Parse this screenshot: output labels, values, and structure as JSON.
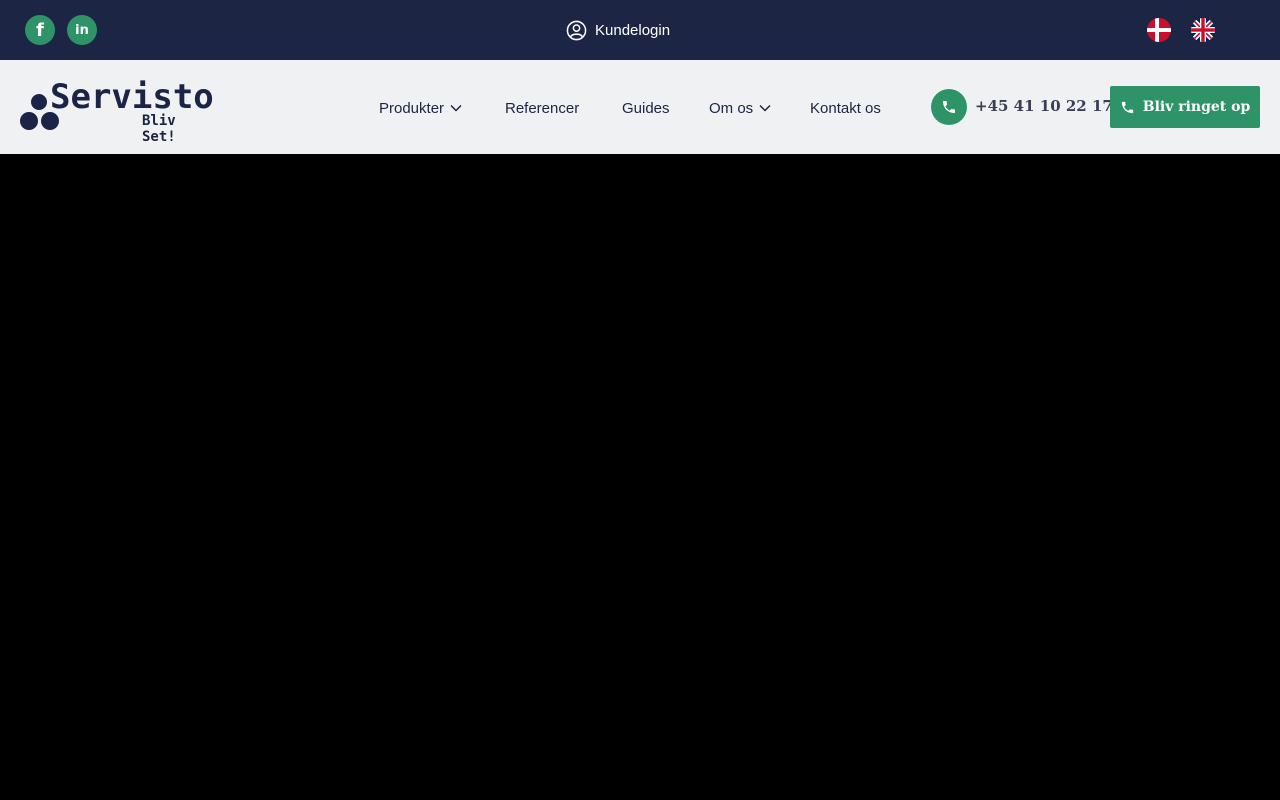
{
  "colors": {
    "topbar_bg": "#1d2545",
    "header_bg": "#f0f1f3",
    "accent_green": "#2e9367",
    "brand_navy": "#1b2446",
    "hero_bg": "#000000"
  },
  "topbar": {
    "social": [
      {
        "icon": "facebook-icon",
        "glyph": "f"
      },
      {
        "icon": "linkedin-icon",
        "glyph": "in"
      }
    ],
    "login_label": "Kundelogin",
    "languages": [
      {
        "icon": "danish-flag-icon"
      },
      {
        "icon": "uk-flag-icon"
      }
    ]
  },
  "header": {
    "logo": {
      "word": "Servisto",
      "tagline": "Bliv Set!"
    },
    "nav": [
      {
        "label": "Produkter",
        "has_dropdown": true
      },
      {
        "label": "Referencer",
        "has_dropdown": false
      },
      {
        "label": "Guides",
        "has_dropdown": false
      },
      {
        "label": "Om os",
        "has_dropdown": true
      },
      {
        "label": "Kontakt os",
        "has_dropdown": false
      }
    ],
    "phone": "+45 41 10 22 17",
    "cta_label": "Bliv ringet op"
  }
}
